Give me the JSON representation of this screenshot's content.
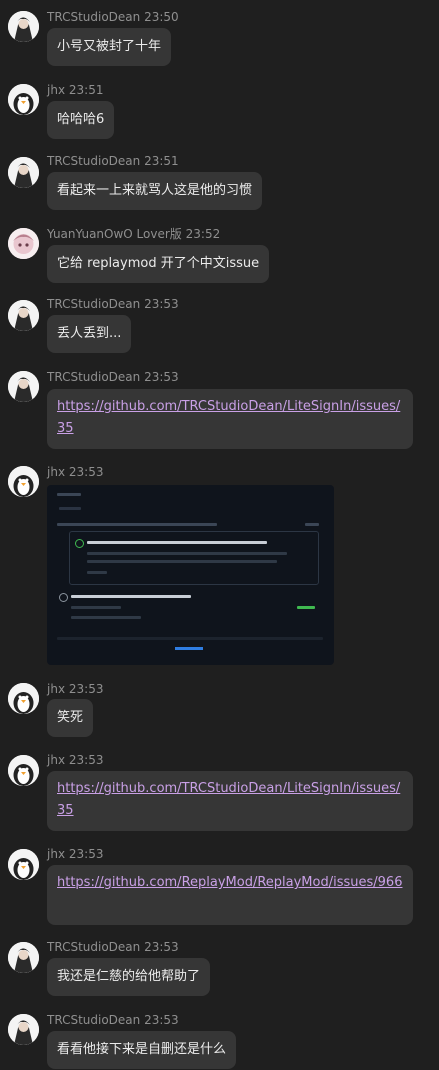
{
  "messages": [
    {
      "user": "TRCStudioDean",
      "time": "23:50",
      "text": "小号又被封了十年"
    },
    {
      "user": "jhx",
      "time": "23:51",
      "text": "哈哈哈6"
    },
    {
      "user": "TRCStudioDean",
      "time": "23:51",
      "text": "看起来一上来就骂人这是他的习惯"
    },
    {
      "user": "YuanYuanOwO Lover版",
      "time": "23:52",
      "text": "它给 replaymod 开了个中文issue"
    },
    {
      "user": "TRCStudioDean",
      "time": "23:53",
      "text": "丢人丢到..."
    },
    {
      "user": "TRCStudioDean",
      "time": "23:53",
      "link": "https://github.com/TRCStudioDean/LiteSignIn/issues/35"
    },
    {
      "user": "jhx",
      "time": "23:53",
      "image": "github-issue-screenshot"
    },
    {
      "user": "jhx",
      "time": "23:53",
      "text": "笑死"
    },
    {
      "user": "jhx",
      "time": "23:53",
      "link": "https://github.com/TRCStudioDean/LiteSignIn/issues/35"
    },
    {
      "user": "jhx",
      "time": "23:53",
      "link": "https://github.com/ReplayMod/ReplayMod/issues/966"
    },
    {
      "user": "TRCStudioDean",
      "time": "23:53",
      "text": "我还是仁慈的给他帮助了"
    },
    {
      "user": "TRCStudioDean",
      "time": "23:53",
      "text": "看看他接下来是自删还是什么"
    }
  ],
  "colors": {
    "background": "#1f1f1f",
    "bubble": "#363636",
    "link": "#c9a0e6",
    "meta": "#8f8f8f"
  }
}
